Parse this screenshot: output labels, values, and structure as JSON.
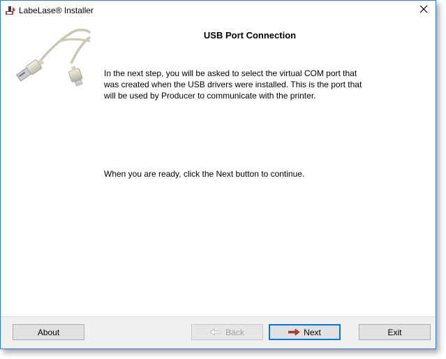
{
  "window": {
    "title": "LabeLase® Installer",
    "icons": {
      "app": "labelase-app-icon",
      "close": "close-icon",
      "illustration": "usb-cable-image"
    }
  },
  "page": {
    "heading": "USB Port Connection",
    "paragraph": "In the next step, you will be asked to select the virtual COM port that was created when the USB drivers were installed. This is the port that will be used by Producer to communicate with the printer.",
    "instruction": "When you are ready, click the Next button to continue."
  },
  "buttons": {
    "about": "About",
    "back": "Back",
    "next": "Next",
    "exit": "Exit"
  },
  "colors": {
    "window_border": "#2b79d8",
    "default_button_border": "#0078d7",
    "next_arrow": "#c0392b",
    "footer_bg": "#f0f0f0"
  }
}
